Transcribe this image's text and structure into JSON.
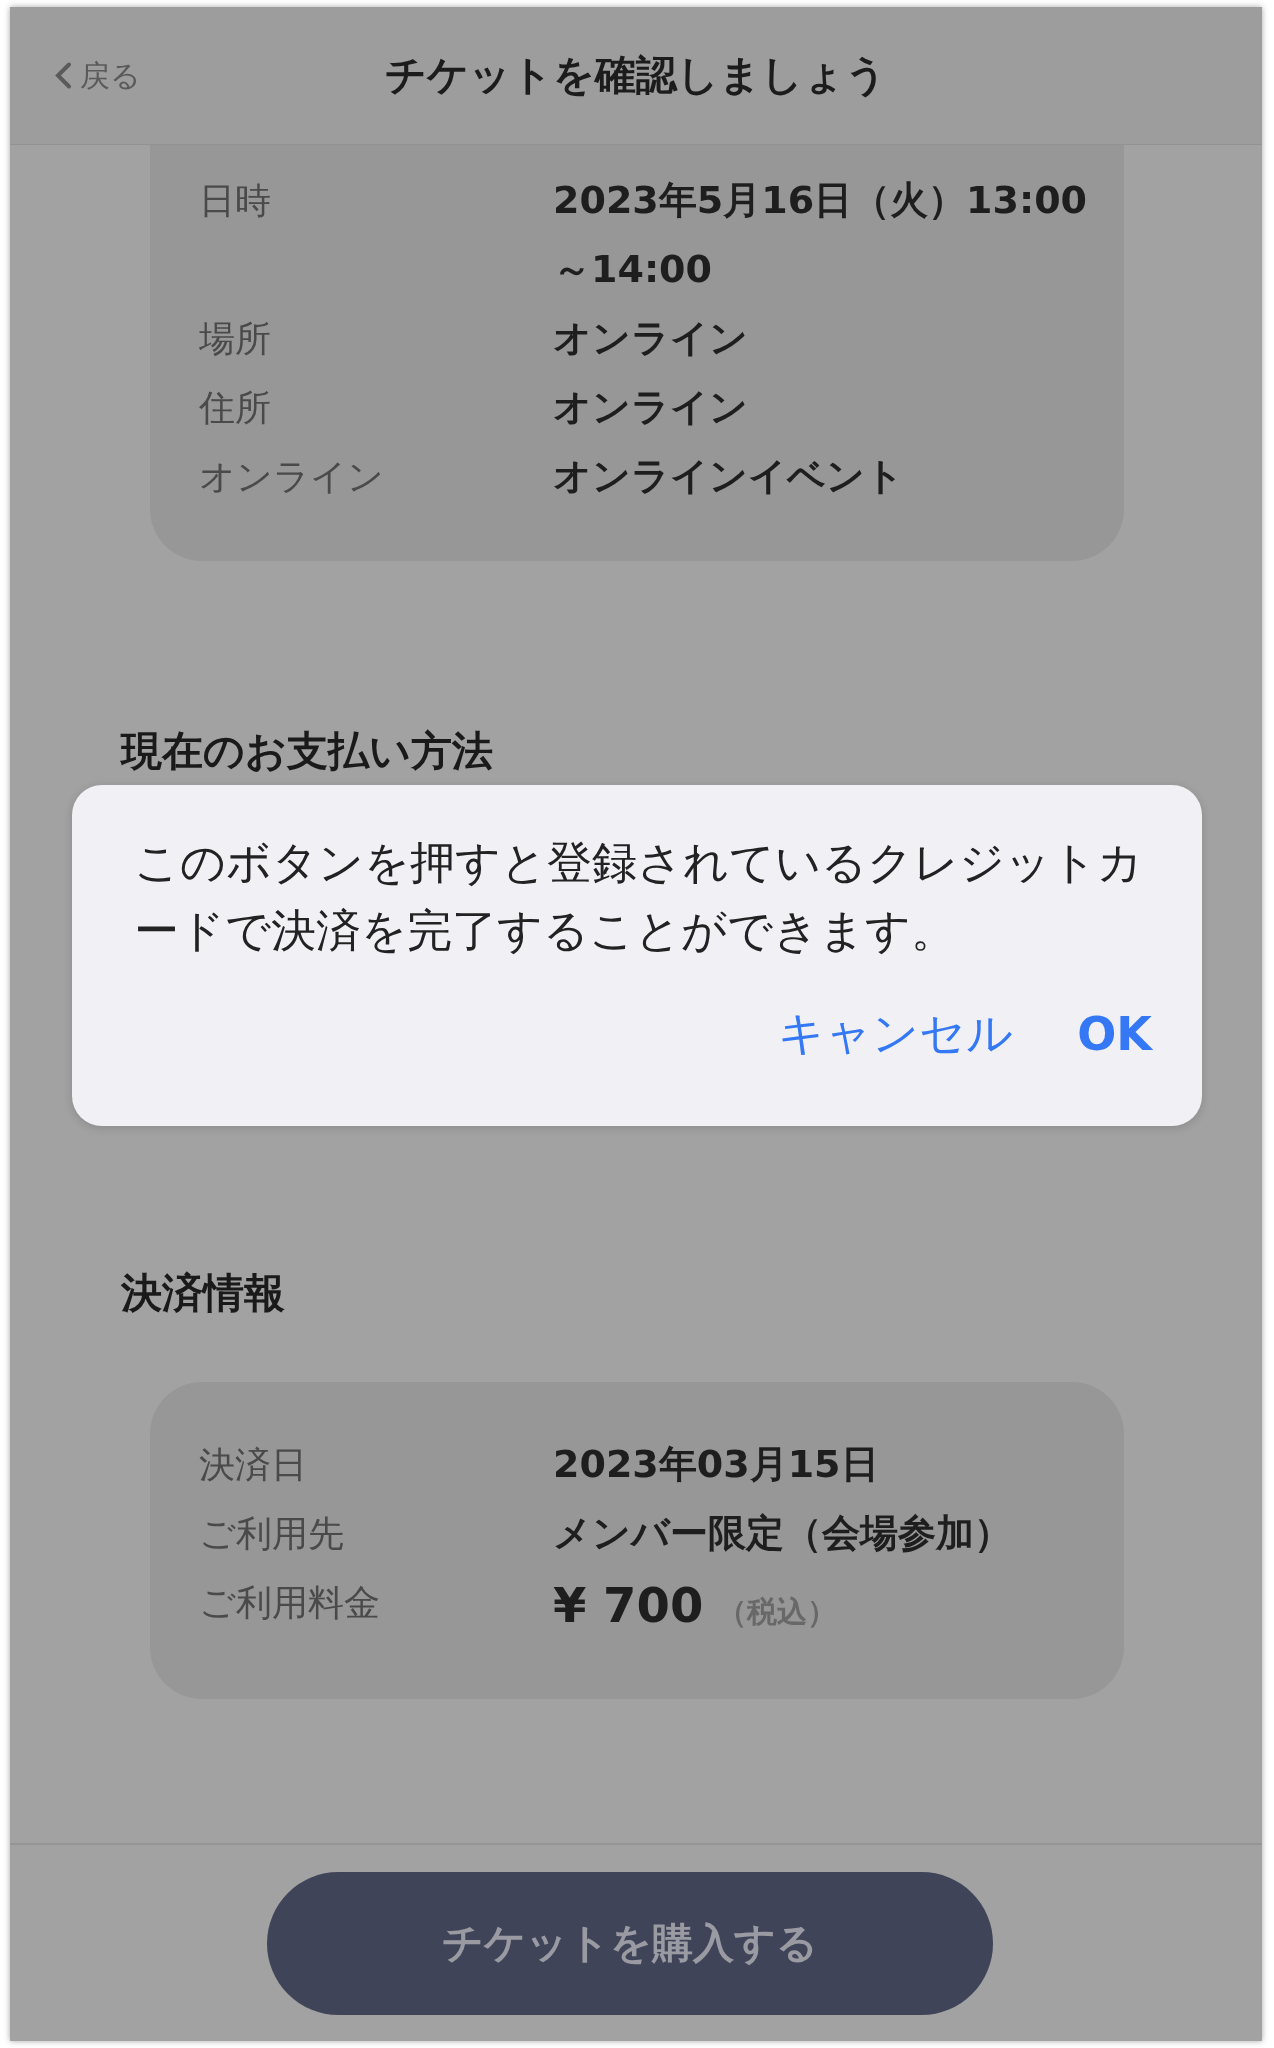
{
  "header": {
    "back": "戻る",
    "title": "チケットを確認しましょう"
  },
  "event_details": [
    {
      "label": "日時",
      "value": "2023年5月16日（火）13:00～14:00"
    },
    {
      "label": "場所",
      "value": "オンライン"
    },
    {
      "label": "住所",
      "value": "オンライン"
    },
    {
      "label": "オンライン",
      "value": "オンラインイベント"
    }
  ],
  "payment_method": {
    "heading": "現在のお支払い方法"
  },
  "dialog": {
    "message": "このボタンを押すと登録されているクレジットカードで決済を完了することができます。",
    "buttons": [
      {
        "label": "キャンセル",
        "kind": "cancel"
      },
      {
        "label": "OK",
        "kind": "default"
      }
    ]
  },
  "payment_info": {
    "heading": "決済情報",
    "rows": [
      {
        "label": "決済日",
        "value": "2023年03月15日",
        "kind": "text"
      },
      {
        "label": "ご利用先",
        "value": "メンバー限定（会場参加）",
        "kind": "text"
      },
      {
        "label": "ご利用料金",
        "value": "¥ 700",
        "note": "（税込）",
        "kind": "price"
      }
    ]
  },
  "footer": {
    "button": "チケットを購入する"
  }
}
